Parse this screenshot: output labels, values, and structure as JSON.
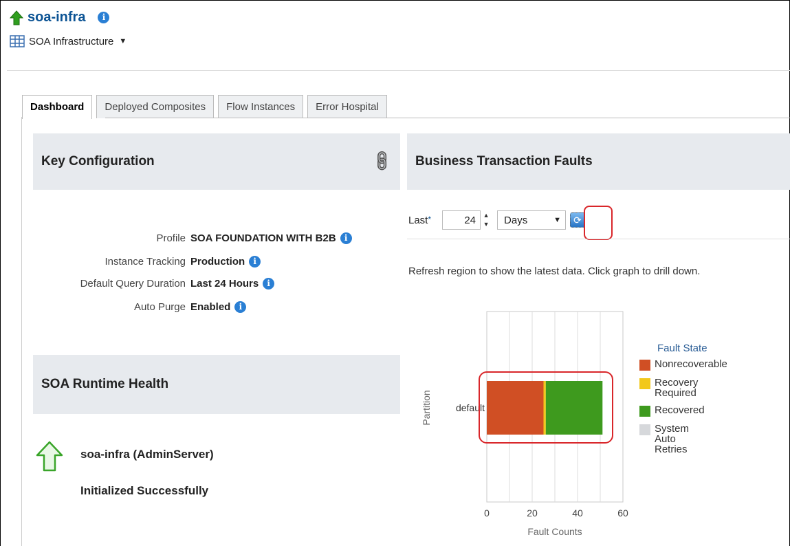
{
  "header": {
    "title": "soa-infra",
    "subtitle": "SOA Infrastructure"
  },
  "tabs": [
    {
      "label": "Dashboard",
      "active": true
    },
    {
      "label": "Deployed Composites",
      "active": false
    },
    {
      "label": "Flow Instances",
      "active": false
    },
    {
      "label": "Error Hospital",
      "active": false
    }
  ],
  "key_configuration": {
    "title": "Key Configuration",
    "rows": [
      {
        "label": "Profile",
        "value": "SOA FOUNDATION WITH B2B"
      },
      {
        "label": "Instance Tracking",
        "value": "Production"
      },
      {
        "label": "Default Query Duration",
        "value": "Last 24 Hours"
      },
      {
        "label": "Auto Purge",
        "value": "Enabled"
      }
    ]
  },
  "business_faults": {
    "title": "Business Transaction Faults",
    "last_label": "Last",
    "required_mark": "*",
    "duration_value": "24",
    "unit_value": "Days",
    "hint": "Refresh region to show the latest data. Click graph to drill down."
  },
  "chart_data": {
    "type": "bar",
    "orientation": "horizontal",
    "stacked": true,
    "categories": [
      "default"
    ],
    "series": [
      {
        "name": "Nonrecoverable",
        "values": [
          25
        ]
      },
      {
        "name": "Recovery Required",
        "values": [
          1
        ]
      },
      {
        "name": "Recovered",
        "values": [
          25
        ]
      },
      {
        "name": "System Auto Retries",
        "values": [
          0
        ]
      }
    ],
    "xlabel": "Fault Counts",
    "ylabel": "Partition",
    "xlim": [
      0,
      60
    ],
    "xticks": [
      "0",
      "20",
      "40",
      "60"
    ],
    "legend_title": "Fault State",
    "legend_position": "right",
    "grid": true,
    "colors": {
      "Nonrecoverable": "#d04f24",
      "Recovery Required": "#f2c81b",
      "Recovered": "#3e9a1e",
      "System Auto Retries": "#d6d8db"
    }
  },
  "runtime_health": {
    "title": "SOA Runtime Health",
    "server": "soa-infra (AdminServer)",
    "status": "Initialized Successfully"
  },
  "colors": {
    "accent": "#0b5394",
    "info_icon": "#2a7fd4",
    "highlight": "#d9262a",
    "panel_header": "#e7eaee"
  },
  "icons": {
    "status": "up-arrow-icon",
    "info": "info-icon",
    "link": "link-icon",
    "refresh": "refresh-icon"
  }
}
